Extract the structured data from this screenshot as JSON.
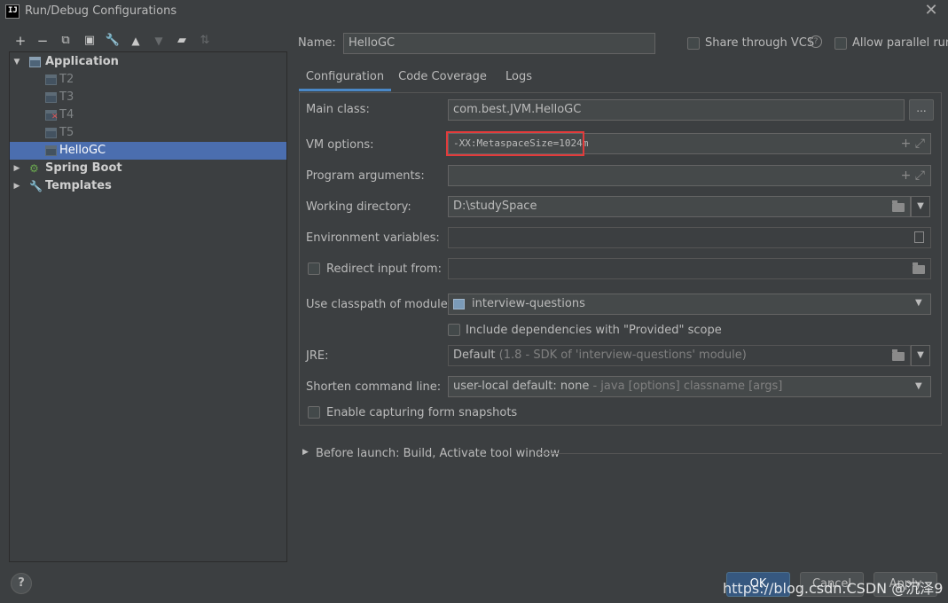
{
  "window": {
    "title": "Run/Debug Configurations",
    "logo_text": "IJ"
  },
  "toolbar": {
    "icons": [
      "add-icon",
      "remove-icon",
      "copy-icon",
      "save-icon",
      "wrench-icon",
      "move-up-icon",
      "move-down-icon",
      "new-folder-icon",
      "sort-icon"
    ]
  },
  "tree": {
    "application_label": "Application",
    "items": [
      {
        "label": "T2",
        "error": false
      },
      {
        "label": "T3",
        "error": false
      },
      {
        "label": "T4",
        "error": true
      },
      {
        "label": "T5",
        "error": false
      },
      {
        "label": "HelloGC",
        "error": false,
        "selected": true
      }
    ],
    "spring_boot_label": "Spring Boot",
    "templates_label": "Templates"
  },
  "header": {
    "name_label": "Name:",
    "name_value": "HelloGC",
    "share_vcs_label": "Share through VCS",
    "allow_parallel_label": "Allow parallel run"
  },
  "tabs": [
    {
      "label": "Configuration",
      "active": true
    },
    {
      "label": "Code Coverage",
      "active": false
    },
    {
      "label": "Logs",
      "active": false
    }
  ],
  "form": {
    "main_class_label": "Main class:",
    "main_class_value": "com.best.JVM.HelloGC",
    "browse_label": "...",
    "vm_options_label": "VM options:",
    "vm_options_value": "-XX:MetaspaceSize=1024m",
    "program_args_label": "Program arguments:",
    "program_args_value": "",
    "working_dir_label": "Working directory:",
    "working_dir_value": "D:\\studySpace",
    "env_vars_label": "Environment variables:",
    "env_vars_value": "",
    "redirect_input_label": "Redirect input from:",
    "classpath_label": "Use classpath of module:",
    "classpath_value": "interview-questions",
    "include_deps_label": "Include dependencies with \"Provided\" scope",
    "jre_label": "JRE:",
    "jre_value": "Default",
    "jre_hint": "(1.8 - SDK of 'interview-questions' module)",
    "shorten_label": "Shorten command line:",
    "shorten_value": "user-local default: none",
    "shorten_hint": "- java [options] classname [args]",
    "snapshots_label": "Enable capturing form snapshots"
  },
  "before_launch": {
    "label": "Before launch: Build, Activate tool window"
  },
  "buttons": {
    "ok_label": "OK",
    "cancel_label": "Cancel",
    "apply_label": "Apply"
  },
  "watermark": "https://blog.csdn.CSDN @沉泽9",
  "colors": {
    "selection": "#4b6eaf",
    "highlight_box": "#e33b3b",
    "tab_underline": "#4a88c7",
    "ok_button": "#365880"
  }
}
